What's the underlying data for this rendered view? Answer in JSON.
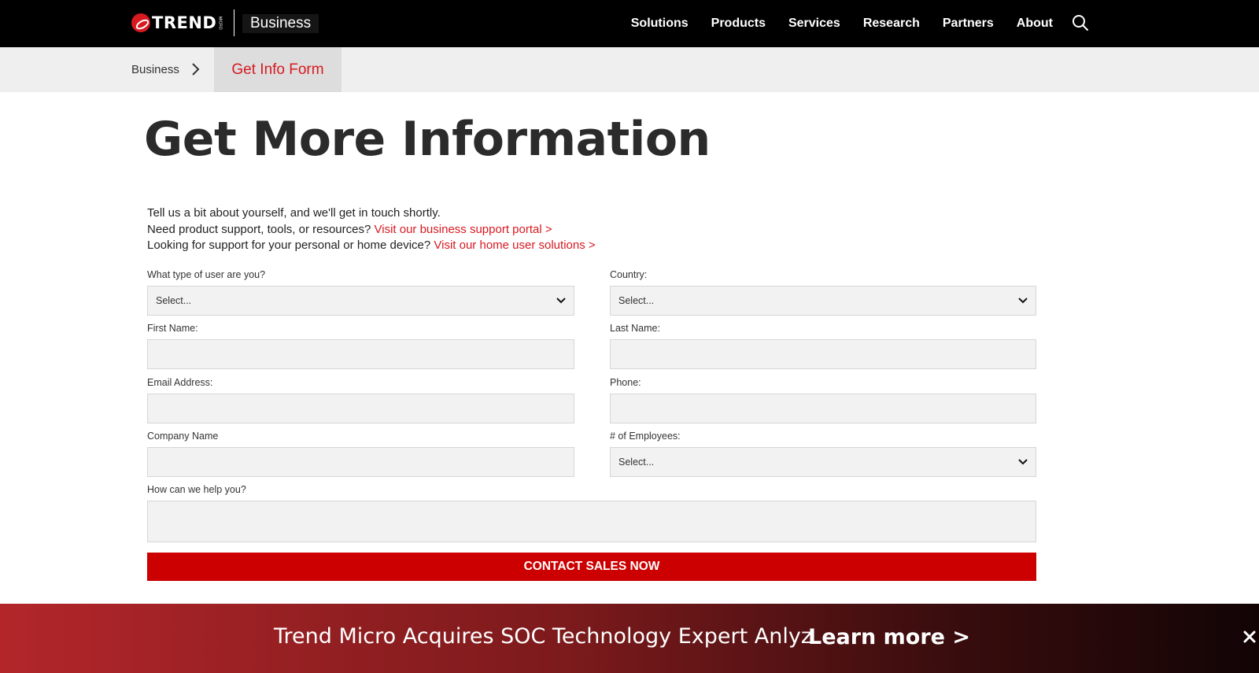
{
  "header": {
    "logo_text": "TREND",
    "logo_sub": "MICRO",
    "section_label": "Business",
    "nav": [
      "Solutions",
      "Products",
      "Services",
      "Research",
      "Partners",
      "About"
    ]
  },
  "breadcrumb": {
    "parent": "Business",
    "current": "Get Info Form"
  },
  "page": {
    "title": "Get More Information",
    "intro_line1": "Tell us a bit about yourself, and we'll get in touch shortly.",
    "intro_line2": "Need product support, tools, or resources?",
    "intro_link2": "Visit our business support portal >",
    "intro_line3": "Looking for support for your personal or home device?",
    "intro_link3": "Visit our home user solutions >"
  },
  "form": {
    "user_type": {
      "label": "What type of user are you?",
      "value": "Select..."
    },
    "country": {
      "label": "Country:",
      "value": "Select..."
    },
    "first_name": {
      "label": "First Name:",
      "value": ""
    },
    "last_name": {
      "label": "Last Name:",
      "value": ""
    },
    "email": {
      "label": "Email Address:",
      "value": ""
    },
    "phone": {
      "label": "Phone:",
      "value": ""
    },
    "company": {
      "label": "Company Name",
      "value": ""
    },
    "employees": {
      "label": "# of Employees:",
      "value": "Select..."
    },
    "help": {
      "label": "How can we help you?",
      "value": ""
    },
    "submit_label": "CONTACT SALES NOW"
  },
  "banner": {
    "text": "Trend Micro Acquires SOC Technology Expert Anlyz",
    "link": "Learn more >"
  },
  "colors": {
    "brand_red": "#d71920",
    "button_red": "#cc0000",
    "nav_bg": "#000000"
  }
}
